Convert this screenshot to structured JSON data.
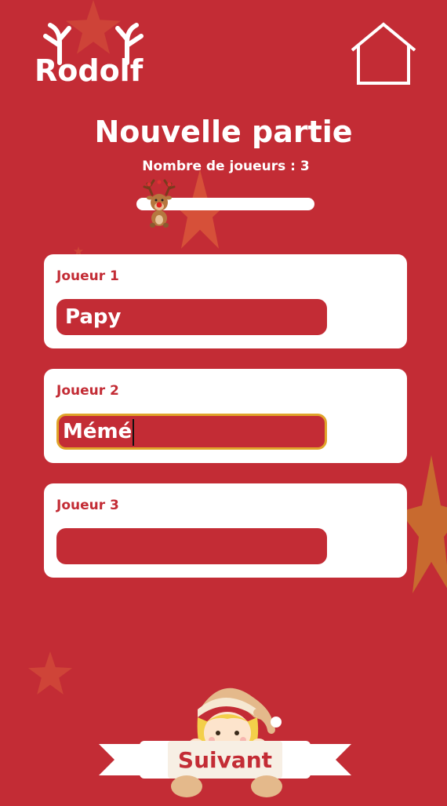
{
  "app": {
    "logo_text": "Rodolf"
  },
  "header": {
    "home_icon": "home-icon"
  },
  "page": {
    "title": "Nouvelle partie",
    "player_count_label": "Nombre de joueurs : 3",
    "player_count": 3
  },
  "players": [
    {
      "label": "Joueur 1",
      "value": "Papy",
      "placeholder": ""
    },
    {
      "label": "Joueur 2",
      "value": "Mémé",
      "placeholder": ""
    },
    {
      "label": "Joueur 3",
      "value": "",
      "placeholder": ""
    }
  ],
  "footer": {
    "next_label": "Suivant"
  },
  "colors": {
    "background": "#c32c35",
    "card": "#ffffff",
    "focus_border": "#e0a42a",
    "star": "#d9573a"
  }
}
